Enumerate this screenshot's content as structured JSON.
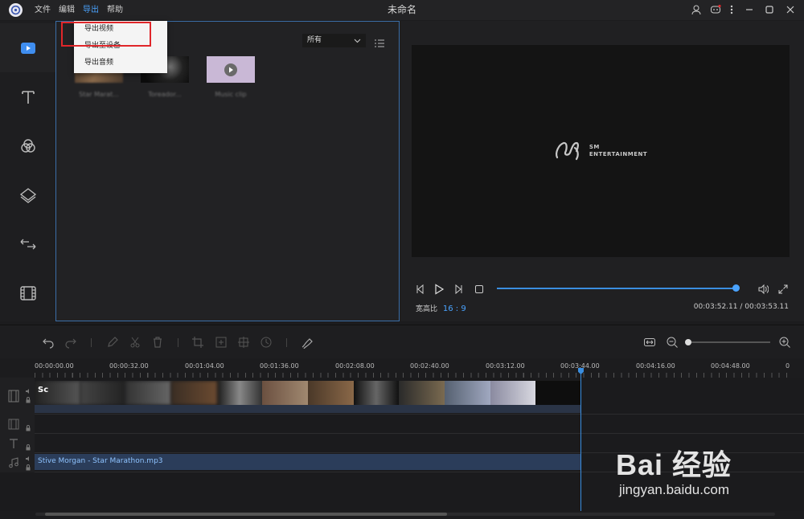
{
  "app": {
    "title": "未命名"
  },
  "menu": [
    "文件",
    "编辑",
    "导出",
    "帮助"
  ],
  "active_menu_index": 2,
  "export_menu": [
    "导出视频",
    "导出至设备",
    "导出音频"
  ],
  "media": {
    "filter_value": "所有",
    "thumbnails": [
      {
        "label": "Star Marat...",
        "color": "#6a5240"
      },
      {
        "label": "Toreador...",
        "color": "#181818"
      },
      {
        "label": "Music clip",
        "color": "#c9b8d6"
      }
    ]
  },
  "sidebar": [
    "media-tab",
    "text-tab",
    "filters-tab",
    "overlays-tab",
    "transitions-tab",
    "elements-tab"
  ],
  "preview": {
    "logo_line1": "SM",
    "logo_line2": "ENTERTAINMENT",
    "aspect_label": "宽高比",
    "aspect_value": "16 : 9",
    "timecode": "00:03:52.11 / 00:03:53.11",
    "progress": 0.996
  },
  "timeline": {
    "ruler": [
      "00:00:00.00",
      "00:00:32.00",
      "00:01:04.00",
      "00:01:36.00",
      "00:02:08.00",
      "00:02:40.00",
      "00:03:12.00",
      "00:03:44.00",
      "00:04:16.00",
      "00:04:48.00",
      "0"
    ],
    "video_clip_title": "Sc",
    "audio_clip_title": "Stive Morgan - Star Marathon.mp3"
  },
  "watermark": {
    "main": "Bai 经验",
    "sub": "jingyan.baidu.com"
  },
  "colors": {
    "accent": "#4aa3ff",
    "highlight_box": "#e0262a"
  }
}
